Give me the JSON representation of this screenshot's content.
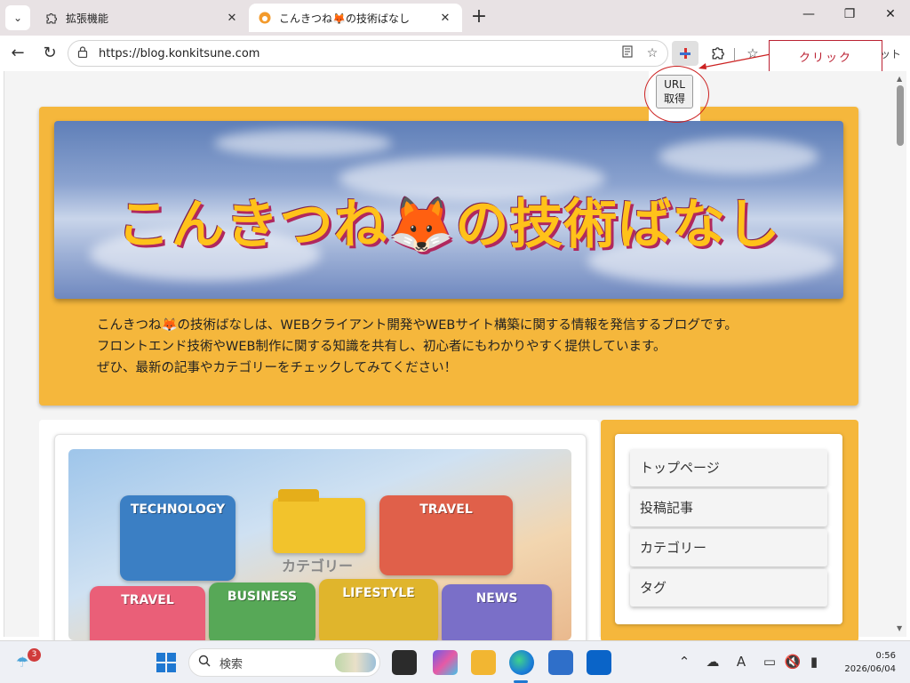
{
  "tabs": [
    {
      "label": "拡張機能",
      "icon": "puzzle-icon"
    },
    {
      "label": "こんきつね🦊の技術ばなし",
      "icon": "fox-favicon-icon"
    }
  ],
  "address": {
    "url": "https://blog.konkitsune.com"
  },
  "callout": {
    "text": "クリック",
    "cut_text": "ット"
  },
  "popup": {
    "button_line1": "URL",
    "button_line2": "取得"
  },
  "hero": {
    "title": "こんきつね🦊の技術ばなし",
    "desc1": "こんきつね🦊の技術ばなしは、WEBクライアント開発やWEBサイト構築に関する情報を発信するブログです。",
    "desc2": "フロントエンド技術やWEB制作に関する知識を共有し、初心者にもわかりやすく提供しています。",
    "desc3": "ぜひ、最新の記事やカテゴリーをチェックしてみてください！"
  },
  "card_image": {
    "tiles": [
      "TECHNOLOGY",
      "TRAVEL",
      "TRAVEL",
      "BUSINESS",
      "LIFESTYLE",
      "NEWS"
    ],
    "folder_label": "カテゴリー"
  },
  "sidebar": {
    "items": [
      {
        "label": "トップページ"
      },
      {
        "label": "投稿記事"
      },
      {
        "label": "カテゴリー"
      },
      {
        "label": "タグ"
      }
    ]
  },
  "taskbar": {
    "weather_badge": "3",
    "search_label": "検索",
    "time": "0:56",
    "date": "2026/06/04"
  },
  "colors": {
    "accent": "#f5b73c",
    "title": "#ffc21a",
    "callout": "#bb2233"
  }
}
